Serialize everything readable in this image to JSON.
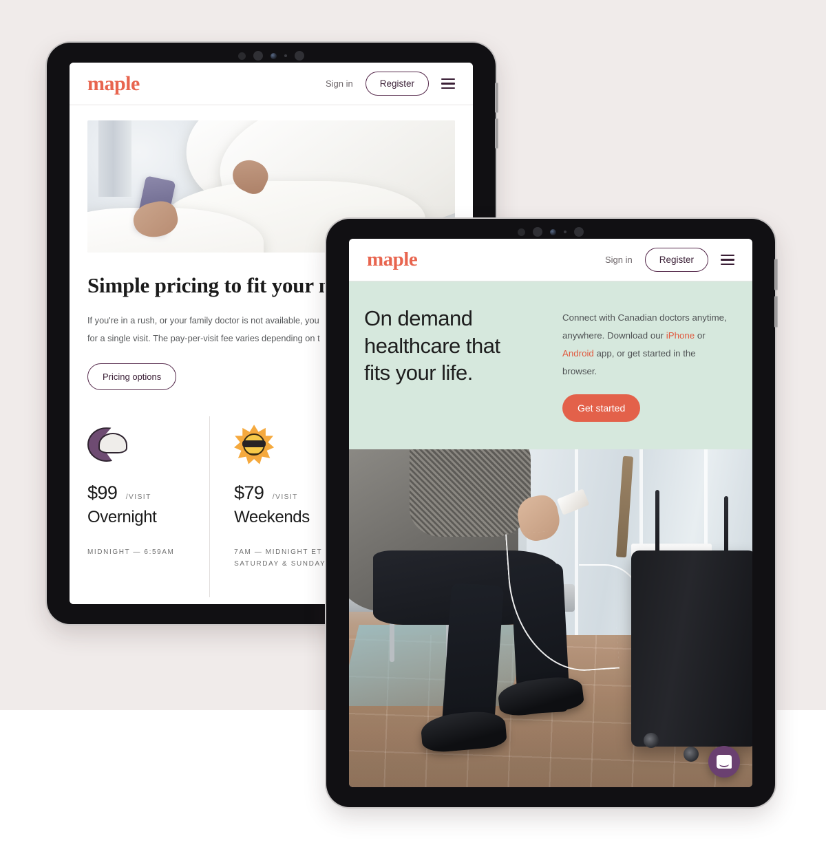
{
  "page": {
    "background_color": "#F0EBEA",
    "lower_background_color": "#FFFFFF"
  },
  "brand": {
    "name": "maple",
    "color": "#E8654F",
    "accent_purple": "#54284A",
    "accent_coral": "#E3614A",
    "mint": "#D6E8DD"
  },
  "tablet_pricing": {
    "device_label": "tablet-device-pricing",
    "header": {
      "logo": "maple",
      "sign_in": "Sign in",
      "register": "Register",
      "menu_icon": "hamburger-menu-icon"
    },
    "hero_image_alt": "person-in-bed-with-phone",
    "heading": "Simple pricing to fit your needs",
    "paragraph_line_1": "If you're in a rush, or your family doctor is not available, you",
    "paragraph_line_2": "for a single visit. The pay-per-visit fee varies depending on t",
    "cta": "Pricing options",
    "pricing_cards": [
      {
        "icon": "crescent-moon-icon",
        "amount": "$99",
        "per": "/VISIT",
        "title": "Overnight",
        "hours_line_1": "MIDNIGHT — 6:59AM",
        "hours_line_2": ""
      },
      {
        "icon": "sun-with-sunglasses-icon",
        "amount": "$79",
        "per": "/VISIT",
        "title": "Weekends",
        "hours_line_1": "7AM — MIDNIGHT ET",
        "hours_line_2": "SATURDAY & SUNDAY"
      }
    ]
  },
  "tablet_ondemand": {
    "device_label": "tablet-device-ondemand",
    "header": {
      "logo": "maple",
      "sign_in": "Sign in",
      "register": "Register",
      "menu_icon": "hamburger-menu-icon"
    },
    "hero": {
      "heading_line_1": "On demand",
      "heading_line_2": "healthcare that",
      "heading_line_3": "fits your life.",
      "body_prefix": "Connect with Canadian doctors anytime, anywhere. Download our ",
      "link_iphone": "iPhone",
      "body_middle": " or ",
      "link_android": "Android",
      "body_suffix": " app, or get started in the browser.",
      "cta": "Get started"
    },
    "photo_alt": "traveler-sitting-in-airport-with-suitcase",
    "chat_widget": {
      "icon": "chat-smile-icon",
      "color": "#6A4070"
    }
  }
}
